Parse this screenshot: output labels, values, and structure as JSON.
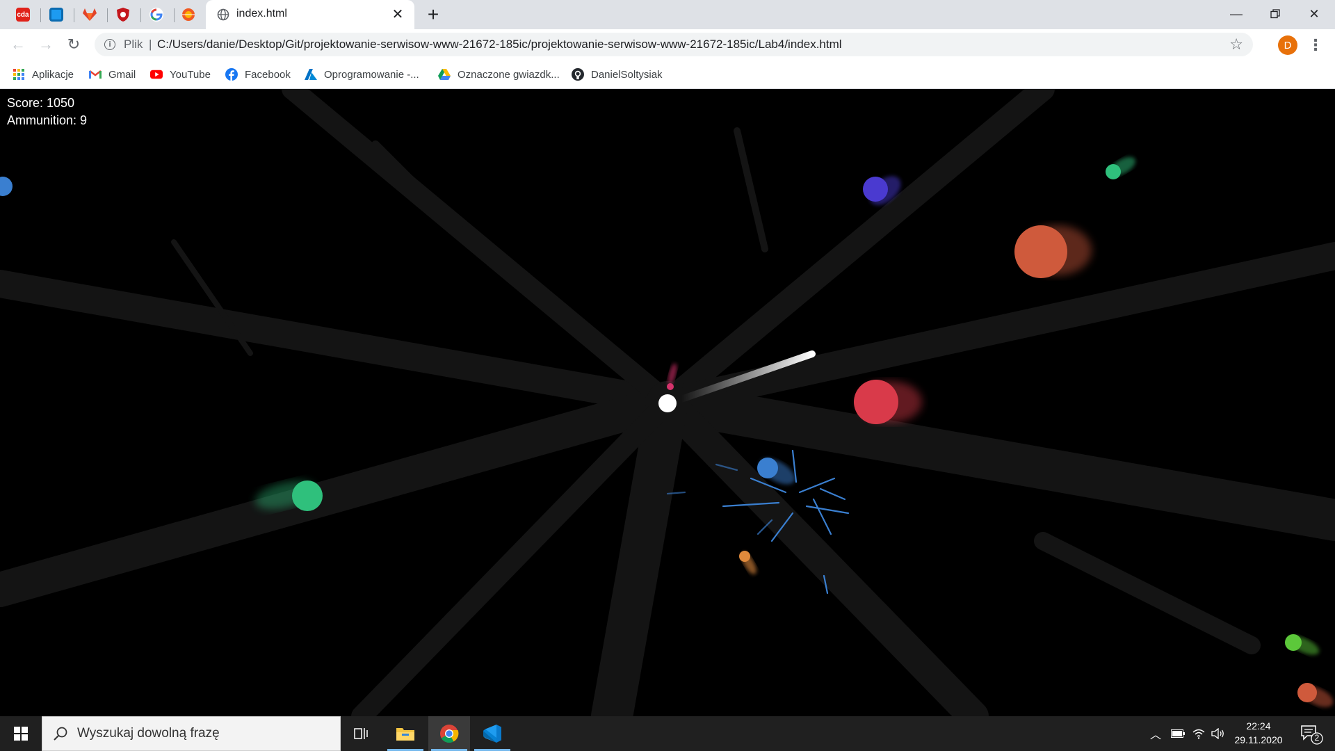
{
  "browser": {
    "tab_title": "index.html",
    "pinned_tabs": [
      {
        "name": "cda",
        "label": "cda",
        "color": "#e0221a"
      },
      {
        "name": "screen",
        "label": "",
        "color": "#1d9bf0"
      },
      {
        "name": "gitlab",
        "label": "",
        "color": "#e24329"
      },
      {
        "name": "shield",
        "label": "",
        "color": "#c4161c"
      },
      {
        "name": "google",
        "label": "G",
        "color": "#ffffff"
      },
      {
        "name": "orange",
        "label": "",
        "color": "#f05a23"
      }
    ],
    "url_scheme": "Plik",
    "url": "C:/Users/danie/Desktop/Git/projektowanie-serwisow-www-21672-185ic/projektowanie-serwisow-www-21672-185ic/Lab4/index.html",
    "profile_initial": "D"
  },
  "bookmarks": [
    {
      "label": "Aplikacje",
      "icon": "apps-grid-icon"
    },
    {
      "label": "Gmail",
      "icon": "gmail-icon"
    },
    {
      "label": "YouTube",
      "icon": "youtube-icon"
    },
    {
      "label": "Facebook",
      "icon": "facebook-icon"
    },
    {
      "label": "Oprogramowanie -...",
      "icon": "azure-icon"
    },
    {
      "label": "Oznaczone gwiazdk...",
      "icon": "drive-icon"
    },
    {
      "label": "DanielSoltysiak",
      "icon": "github-icon"
    }
  ],
  "game": {
    "score_text": "Score: 1050",
    "ammo_text": "Ammunition: 9",
    "colors": {
      "player": "#ffffff",
      "enemy_red": "#d93a4a",
      "enemy_orange": "#cf5a3c",
      "enemy_green": "#2fc07c",
      "enemy_blue": "#3a7fd0",
      "enemy_purple": "#4a3ad0",
      "enemy_lime": "#5cc83a"
    }
  },
  "taskbar": {
    "search_placeholder": "Wyszukaj dowolną frazę",
    "time": "22:24",
    "date": "29.11.2020",
    "notification_count": "2"
  }
}
